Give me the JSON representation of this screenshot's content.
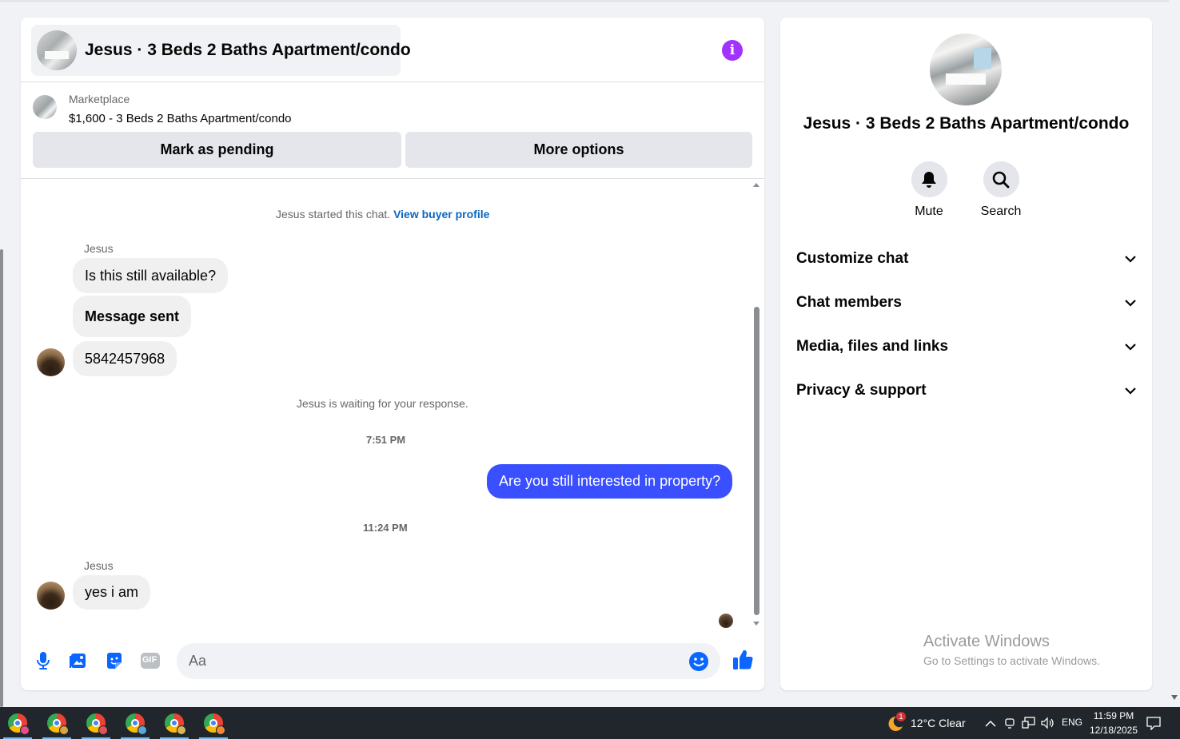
{
  "chat": {
    "title": "Jesus · 3 Beds 2 Baths Apartment/condo",
    "info_icon": "info-icon",
    "listing": {
      "category": "Marketplace",
      "price_title": "$1,600 - 3 Beds 2 Baths Apartment/condo"
    },
    "buttons": {
      "pending": "Mark as pending",
      "more": "More options"
    },
    "started_text": "Jesus started this chat.",
    "view_profile_link": "View buyer profile",
    "messages": {
      "sender1": "Jesus",
      "m1": "Is this still available?",
      "m2": "Message sent",
      "m3": "5842457968",
      "waiting": "Jesus is waiting for your response.",
      "time1": "7:51 PM",
      "out1": "Are you still interested in property?",
      "time2": "11:24 PM",
      "sender2": "Jesus",
      "m4": "yes i am"
    },
    "composer": {
      "placeholder": "Aa",
      "icons": [
        "microphone-icon",
        "photo-icon",
        "sticker-icon",
        "gif-icon",
        "emoji-icon",
        "thumbs-up-icon"
      ],
      "gif_label": "GIF"
    },
    "accent_color": "#3a4fff"
  },
  "details": {
    "title": "Jesus · 3 Beds 2 Baths Apartment/condo",
    "actions": [
      {
        "label": "Mute",
        "icon": "bell-icon"
      },
      {
        "label": "Search",
        "icon": "search-icon"
      }
    ],
    "sections": [
      "Customize chat",
      "Chat members",
      "Media, files and links",
      "Privacy & support"
    ],
    "watermark": {
      "line1": "Activate Windows",
      "line2": "Go to Settings to activate Windows."
    }
  },
  "taskbar": {
    "apps": [
      "chrome-icon",
      "chrome-icon",
      "chrome-icon",
      "chrome-icon",
      "chrome-icon",
      "chrome-icon"
    ],
    "weather_badge": "1",
    "weather": "12°C  Clear",
    "language": "ENG",
    "time": "11:59 PM",
    "date": "12/18/2025"
  }
}
